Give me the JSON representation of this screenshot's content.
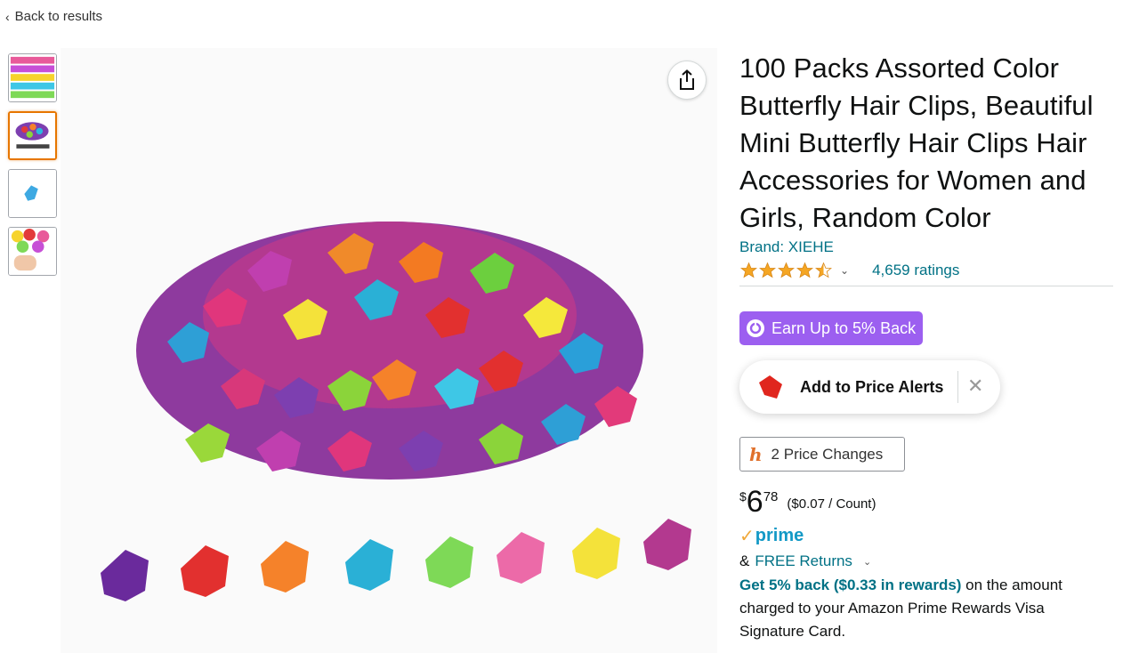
{
  "nav": {
    "back_label": "Back to results"
  },
  "product": {
    "title": "100 Packs Assorted Color Butterfly Hair Clips, Beautiful Mini Butterfly Hair Clips Hair Accessories for Women and Girls, Random Color",
    "brand_label": "Brand: XIEHE",
    "rating": 4.5,
    "ratings_count": "4,659 ratings"
  },
  "extension": {
    "earn_label": "Earn Up to 5% Back",
    "alert_label": "Add to Price Alerts",
    "close_glyph": "✕",
    "price_changes_label": "2 Price Changes"
  },
  "price": {
    "currency": "$",
    "whole": "6",
    "fraction": "78",
    "unit_price": "($0.07 / Count)"
  },
  "prime": {
    "label": "prime"
  },
  "returns": {
    "prefix": "&",
    "link_label": "FREE Returns"
  },
  "rewards": {
    "link_text": "Get 5% back ($0.33 in rewards)",
    "rest_text": " on the amount charged to your Amazon Prime Rewards Visa Signature Card."
  },
  "colors": {
    "link": "#007185",
    "accent_orange": "#e77600",
    "earn_purple": "#9c5ff0",
    "prime_blue": "#1399c6",
    "star": "#f5a623"
  },
  "icons": [
    "chevron-left-icon",
    "share-icon",
    "star-icon",
    "chevron-down-icon",
    "gift-icon",
    "tag-icon",
    "close-icon",
    "honey-h-icon",
    "prime-check-icon"
  ]
}
